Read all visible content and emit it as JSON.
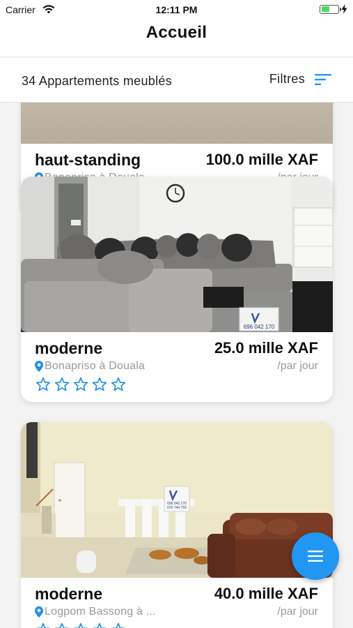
{
  "status_bar": {
    "carrier": "Carrier",
    "time": "12:11 PM"
  },
  "nav": {
    "title": "Accueil"
  },
  "filter_bar": {
    "count_label": "34 Appartements meublés",
    "filter_label": "Filtres"
  },
  "listings": [
    {
      "title": "haut-standing",
      "price": "100.0 mille XAF",
      "location": "Bonapriso à Douala",
      "unit": "/par jour",
      "rating": 0
    },
    {
      "title": "moderne",
      "price": "25.0 mille XAF",
      "location": "Bonapriso à Douala",
      "unit": "/par jour",
      "rating": 0,
      "photo_badge": "696 042 170"
    },
    {
      "title": "moderne",
      "price": "40.0 mille XAF",
      "location": "Logpom Bassong à ...",
      "unit": "/par jour",
      "rating": 0,
      "photo_badge_lines": [
        "696 042 170",
        "676 744 793"
      ]
    }
  ],
  "icons": {
    "location": "map-pin-icon",
    "star": "star-outline-icon",
    "filter": "sort-lines-icon",
    "fab": "menu-icon"
  },
  "colors": {
    "accent": "#2196f3",
    "star": "#1f8fe6",
    "muted_text": "#999999"
  }
}
